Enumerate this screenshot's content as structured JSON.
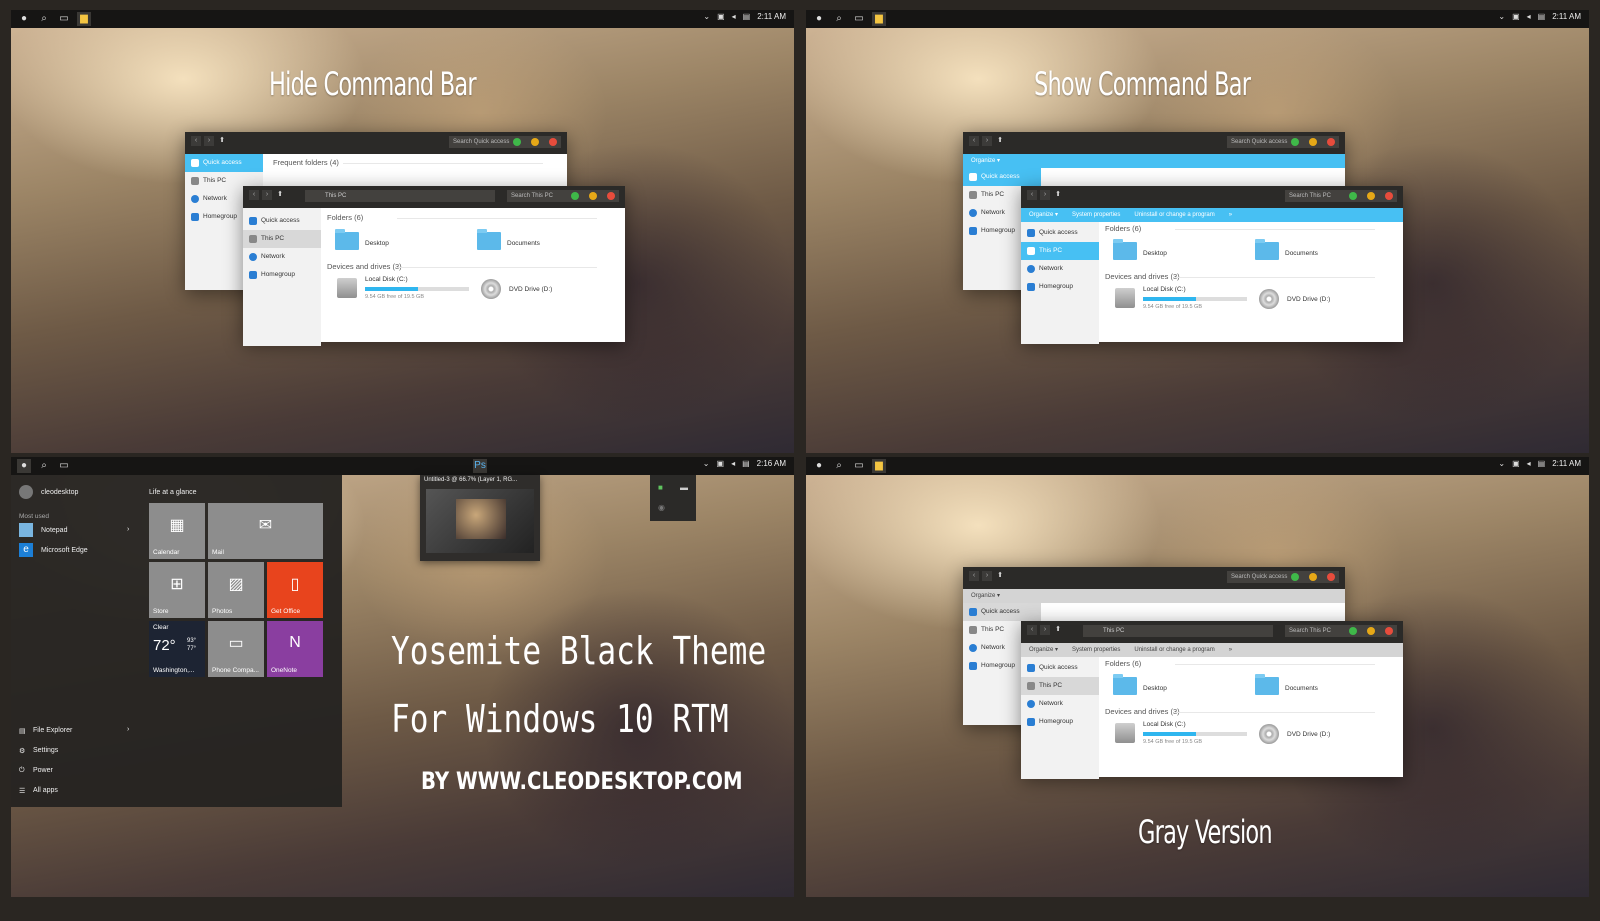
{
  "colors": {
    "accent": "#47c0f3",
    "close": "#e74c3c",
    "min": "#e6a817",
    "max": "#3fb849",
    "office": "#e8441d",
    "onenote": "#8a3ea0"
  },
  "q1": {
    "headline": "Hide Command Bar",
    "clock": "2:11 AM",
    "back": {
      "search": "Search Quick access",
      "nav_sel": "Quick access",
      "frequent": "Frequent folders (4)",
      "items": [
        "Quick access",
        "This PC",
        "Network",
        "Homegroup"
      ]
    },
    "front": {
      "address": "This PC",
      "search": "Search This PC",
      "items": [
        "Quick access",
        "This PC",
        "Network",
        "Homegroup"
      ],
      "folders_head": "Folders (6)",
      "drives_head": "Devices and drives (3)",
      "folders": [
        "Desktop",
        "Documents"
      ],
      "disk": "Local Disk (C:)",
      "disk_free": "9.54 GB free of 19.5 GB",
      "dvd": "DVD Drive (D:)",
      "disk_used": 0.51
    }
  },
  "q2": {
    "headline": "Show Command Bar",
    "clock": "2:11 AM",
    "back": {
      "search": "Search Quick access",
      "organize": "Organize ▾",
      "items": [
        "Quick access",
        "This PC",
        "Network",
        "Homegroup"
      ]
    },
    "front": {
      "search": "Search This PC",
      "organize": "Organize ▾",
      "sysprops": "System properties",
      "uninstall": "Uninstall or change a program",
      "more": "»",
      "items": [
        "Quick access",
        "This PC",
        "Network",
        "Homegroup"
      ],
      "folders_head": "Folders (6)",
      "drives_head": "Devices and drives (3)",
      "folders": [
        "Desktop",
        "Documents"
      ],
      "disk": "Local Disk (C:)",
      "disk_free": "9.54 GB free of 19.5 GB",
      "dvd": "DVD Drive (D:)"
    }
  },
  "q3": {
    "clock": "2:16 AM",
    "user": "cleodesktop",
    "most_used": "Most used",
    "life": "Life at a glance",
    "apps": [
      "Notepad",
      "Microsoft Edge"
    ],
    "bottom": [
      "File Explorer",
      "Settings",
      "Power",
      "All apps"
    ],
    "tiles": {
      "calendar": "Calendar",
      "mail": "Mail",
      "store": "Store",
      "photos": "Photos",
      "office": "Get Office",
      "weather_cond": "Clear",
      "weather_temp": "72°",
      "weather_hi": "93°",
      "weather_lo": "77°",
      "weather_city": "Washington,...",
      "phone": "Phone Compa...",
      "onenote": "OneNote"
    },
    "thumb_title": "Untitled-3 @ 66.7% (Layer 1, RG...",
    "brand1": "Yosemite Black Theme",
    "brand2": "For Windows 10 RTM",
    "brand3": "BY WWW.CLEODESKTOP.COM"
  },
  "q4": {
    "headline": "Gray Version",
    "clock": "2:11 AM",
    "back": {
      "search": "Search Quick access",
      "organize": "Organize ▾",
      "items": [
        "Quick access",
        "This PC",
        "Network",
        "Homegroup"
      ]
    },
    "front": {
      "address": "This PC",
      "search": "Search This PC",
      "organize": "Organize ▾",
      "sysprops": "System properties",
      "uninstall": "Uninstall or change a program",
      "more": "»",
      "items": [
        "Quick access",
        "This PC",
        "Network",
        "Homegroup"
      ],
      "folders_head": "Folders (6)",
      "drives_head": "Devices and drives (3)",
      "folders": [
        "Desktop",
        "Documents"
      ],
      "disk": "Local Disk (C:)",
      "disk_free": "9.54 GB free of 19.5 GB",
      "dvd": "DVD Drive (D:)"
    }
  }
}
